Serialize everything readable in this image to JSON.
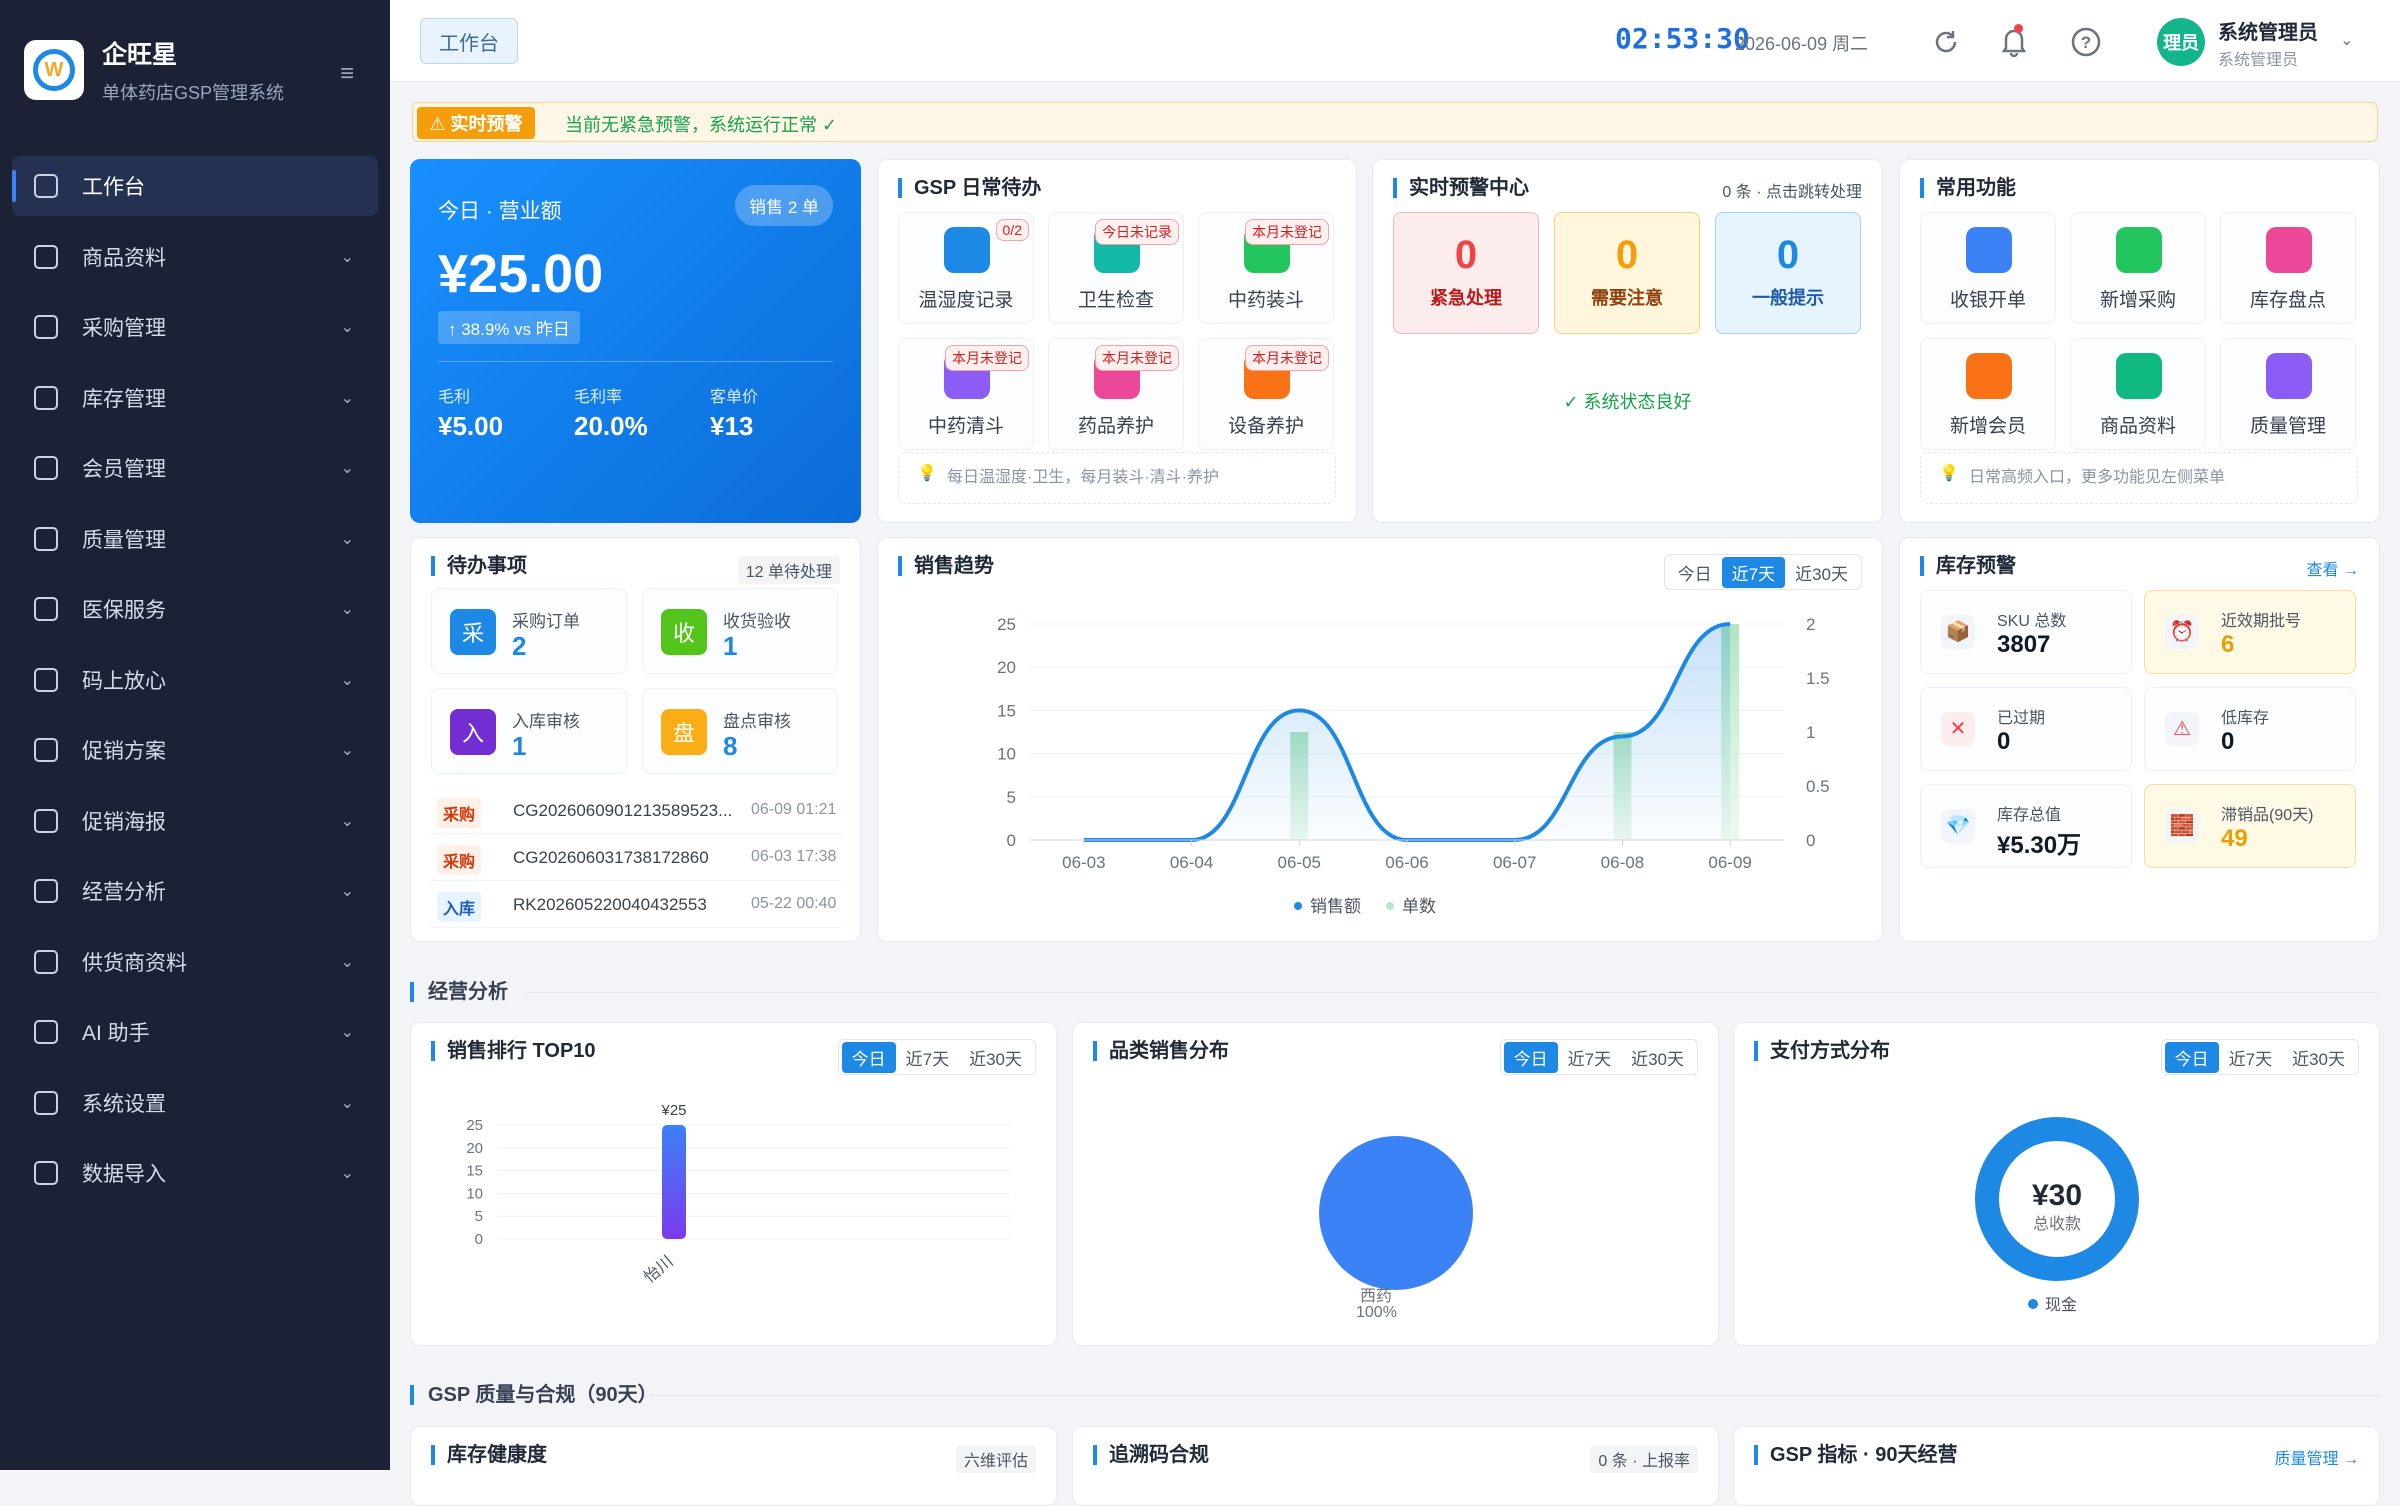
{
  "brand": {
    "title": "企旺星",
    "subtitle": "单体药店GSP管理系统"
  },
  "sidebar": {
    "items": [
      {
        "label": "工作台",
        "active": true,
        "icon": "dashboard-icon"
      },
      {
        "label": "商品资料",
        "icon": "box-icon"
      },
      {
        "label": "采购管理",
        "icon": "cart-icon"
      },
      {
        "label": "库存管理",
        "icon": "warehouse-icon"
      },
      {
        "label": "会员管理",
        "icon": "users-icon"
      },
      {
        "label": "质量管理",
        "icon": "check-badge-icon"
      },
      {
        "label": "医保服务",
        "icon": "shield-icon"
      },
      {
        "label": "码上放心",
        "icon": "qrcode-icon"
      },
      {
        "label": "促销方案",
        "icon": "tag-icon"
      },
      {
        "label": "促销海报",
        "icon": "image-icon"
      },
      {
        "label": "经营分析",
        "icon": "chart-icon"
      },
      {
        "label": "供货商资料",
        "icon": "truck-icon"
      },
      {
        "label": "AI 助手",
        "icon": "robot-icon"
      },
      {
        "label": "系统设置",
        "icon": "gear-icon"
      },
      {
        "label": "数据导入",
        "icon": "import-icon"
      }
    ]
  },
  "header": {
    "tab": "工作台",
    "clock": "02:53:30",
    "date": "2026-06-09 周二",
    "avatar_text": "理员",
    "user_name": "系统管理员",
    "user_role": "系统管理员"
  },
  "alert": {
    "tag": "⚠ 实时预警",
    "message": "当前无紧急预警，系统运行正常 ✓"
  },
  "sales": {
    "title": "今日 · 营业额",
    "badge": "销售 2 单",
    "amount": "¥25.00",
    "compare": "↑ 38.9% vs 昨日",
    "stats": [
      {
        "label": "毛利",
        "value": "¥5.00"
      },
      {
        "label": "毛利率",
        "value": "20.0%"
      },
      {
        "label": "客单价",
        "value": "¥13"
      }
    ]
  },
  "gsp": {
    "title": "GSP 日常待办",
    "tiles": [
      {
        "label": "温湿度记录",
        "badge": "0/2",
        "color": "#1e88e5"
      },
      {
        "label": "卫生检查",
        "badge": "今日未记录",
        "color": "#14b8a6"
      },
      {
        "label": "中药装斗",
        "badge": "本月未登记",
        "color": "#22c55e"
      },
      {
        "label": "中药清斗",
        "badge": "本月未登记",
        "color": "#8b5cf6"
      },
      {
        "label": "药品养护",
        "badge": "本月未登记",
        "color": "#ec4899"
      },
      {
        "label": "设备养护",
        "badge": "本月未登记",
        "color": "#f97316"
      }
    ],
    "hint": "每日温湿度·卫生，每月装斗·清斗·养护"
  },
  "alert_center": {
    "title": "实时预警中心",
    "extra": "0 条 · 点击跳转处理",
    "boxes": [
      {
        "value": "0",
        "label": "紧急处理",
        "bg": "#fdecec",
        "border": "#f5b5b5",
        "color": "#ef4444",
        "lbcolor": "#b91c1c"
      },
      {
        "value": "0",
        "label": "需要注意",
        "bg": "#fff6dc",
        "border": "#f5d27a",
        "color": "#f59e0b",
        "lbcolor": "#92400e"
      },
      {
        "value": "0",
        "label": "一般提示",
        "bg": "#e6f4ff",
        "border": "#a9d3f7",
        "color": "#1e88e5",
        "lbcolor": "#1e5aa8"
      }
    ],
    "status": "✓ 系统状态良好"
  },
  "quick": {
    "title": "常用功能",
    "items": [
      {
        "label": "收银开单",
        "color": "#3b82f6"
      },
      {
        "label": "新增采购",
        "color": "#22c55e"
      },
      {
        "label": "库存盘点",
        "color": "#ec4899"
      },
      {
        "label": "新增会员",
        "color": "#f97316"
      },
      {
        "label": "商品资料",
        "color": "#10b981"
      },
      {
        "label": "质量管理",
        "color": "#8b5cf6"
      }
    ],
    "hint": "日常高频入口，更多功能见左侧菜单"
  },
  "todo": {
    "title": "待办事项",
    "extra": "12 单待处理",
    "tiles": [
      {
        "icon": "采",
        "label": "采购订单",
        "value": "2",
        "color": "#1e88e5"
      },
      {
        "icon": "收",
        "label": "收货验收",
        "value": "1",
        "color": "#52c41a"
      },
      {
        "icon": "入",
        "label": "入库审核",
        "value": "1",
        "color": "#722ed1"
      },
      {
        "icon": "盘",
        "label": "盘点审核",
        "value": "8",
        "color": "#faad14"
      }
    ],
    "rows": [
      {
        "tag": "采购",
        "no": "CG2026060901213589523...",
        "time": "06-09 01:21",
        "bg": "#fff1e8",
        "fg": "#d4380d"
      },
      {
        "tag": "采购",
        "no": "CG202606031738172860",
        "time": "06-03 17:38",
        "bg": "#fff1e8",
        "fg": "#d4380d"
      },
      {
        "tag": "入库",
        "no": "RK202605220040432553",
        "time": "05-22 00:40",
        "bg": "#e6f4ff",
        "fg": "#1d5fbf"
      }
    ]
  },
  "trend": {
    "title": "销售趋势",
    "tabs": [
      "今日",
      "近7天",
      "近30天"
    ],
    "active_tab": 1
  },
  "chart_data": [
    {
      "type": "line",
      "title": "销售趋势",
      "x": [
        "06-03",
        "06-04",
        "06-05",
        "06-06",
        "06-07",
        "06-08",
        "06-09"
      ],
      "series": [
        {
          "name": "销售额",
          "type": "line",
          "values": [
            0,
            0,
            15,
            0,
            0,
            12,
            25
          ]
        },
        {
          "name": "单数",
          "type": "bar",
          "values": [
            0,
            0,
            1,
            0,
            0,
            1,
            2
          ]
        }
      ],
      "ylim": [
        0,
        25
      ],
      "y_ticks": [
        0,
        5,
        10,
        15,
        20,
        25
      ],
      "y2lim": [
        0,
        2
      ],
      "y2_ticks": [
        "0",
        "0.5",
        "1",
        "1.5",
        "2"
      ],
      "legend": "bottom",
      "grid": true
    },
    {
      "type": "bar",
      "title": "销售排行 TOP10",
      "categories": [
        "怡川"
      ],
      "values": [
        25
      ],
      "data_labels": [
        "¥25"
      ],
      "ylim": [
        0,
        25
      ],
      "y_ticks": [
        0,
        5,
        10,
        15,
        20,
        25
      ],
      "grid": true
    },
    {
      "type": "pie",
      "title": "品类销售分布",
      "labels": [
        "西药"
      ],
      "values": [
        100
      ],
      "data_labels": [
        "100%"
      ]
    },
    {
      "type": "pie",
      "title": "支付方式分布",
      "labels": [
        "现金"
      ],
      "values": [
        30
      ],
      "center_value": "¥30",
      "center_label": "总收款",
      "legend": "bottom"
    }
  ],
  "inventory": {
    "title": "库存预警",
    "link": "查看 →",
    "tiles": [
      {
        "label": "SKU 总数",
        "value": "3807",
        "icon": "📦",
        "warn": false
      },
      {
        "label": "近效期批号",
        "value": "6",
        "icon": "⏰",
        "warn": true
      },
      {
        "label": "已过期",
        "value": "0",
        "icon": "✕",
        "warn": false
      },
      {
        "label": "低库存",
        "value": "0",
        "icon": "⚠",
        "warn": false
      },
      {
        "label": "库存总值",
        "value": "¥5.30万",
        "icon": "💎",
        "warn": false
      },
      {
        "label": "滞销品(90天)",
        "value": "49",
        "icon": "🧱",
        "warn": true
      }
    ]
  },
  "analysis": {
    "title": "经营分析",
    "tabs": [
      "今日",
      "近7天",
      "近30天"
    ],
    "rank_title": "销售排行 TOP10",
    "cat_title": "品类销售分布",
    "pay_title": "支付方式分布"
  },
  "gsp_section": {
    "title": "GSP 质量与合规（90天）",
    "cards": [
      {
        "title": "库存健康度",
        "extra": "六维评估"
      },
      {
        "title": "追溯码合规",
        "extra": "0 条 · 上报率"
      },
      {
        "title": "GSP 指标 · 90天经营",
        "extra": "质量管理 →"
      }
    ]
  }
}
